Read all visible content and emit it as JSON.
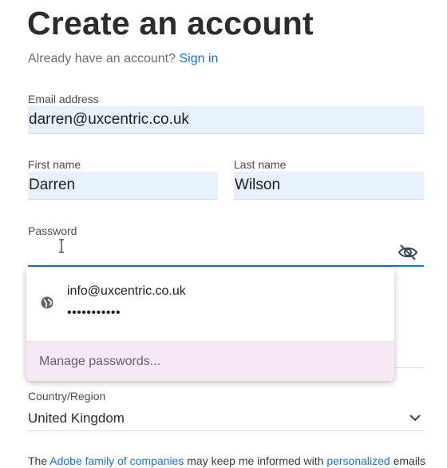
{
  "page": {
    "title": "Create an account",
    "already_text": "Already have an account?",
    "sign_in_link": "Sign in"
  },
  "form": {
    "email": {
      "label": "Email address",
      "value": "darren@uxcentric.co.uk"
    },
    "first_name": {
      "label": "First name",
      "value": "Darren"
    },
    "last_name": {
      "label": "Last name",
      "value": "Wilson"
    },
    "password": {
      "label": "Password",
      "value": ""
    },
    "country": {
      "label": "Country/Region",
      "value": "United Kingdom"
    }
  },
  "autofill_popup": {
    "account": "info@uxcentric.co.uk",
    "masked_password": "•••••••••••",
    "manage_label": "Manage passwords..."
  },
  "footer": {
    "text_1": "The ",
    "link_1": "Adobe family of companies",
    "text_2": " may keep me informed with ",
    "link_2": "personalized",
    "text_3": " emails"
  },
  "icons": {
    "password_visibility": "eye-off-icon",
    "globe": "globe-icon",
    "chevron": "chevron-down-icon",
    "cursor": "text-cursor-icon"
  },
  "colors": {
    "accent": "#1473e6",
    "autofill_bg": "#e8f0fe",
    "manage_bg": "#f6e8f4"
  }
}
